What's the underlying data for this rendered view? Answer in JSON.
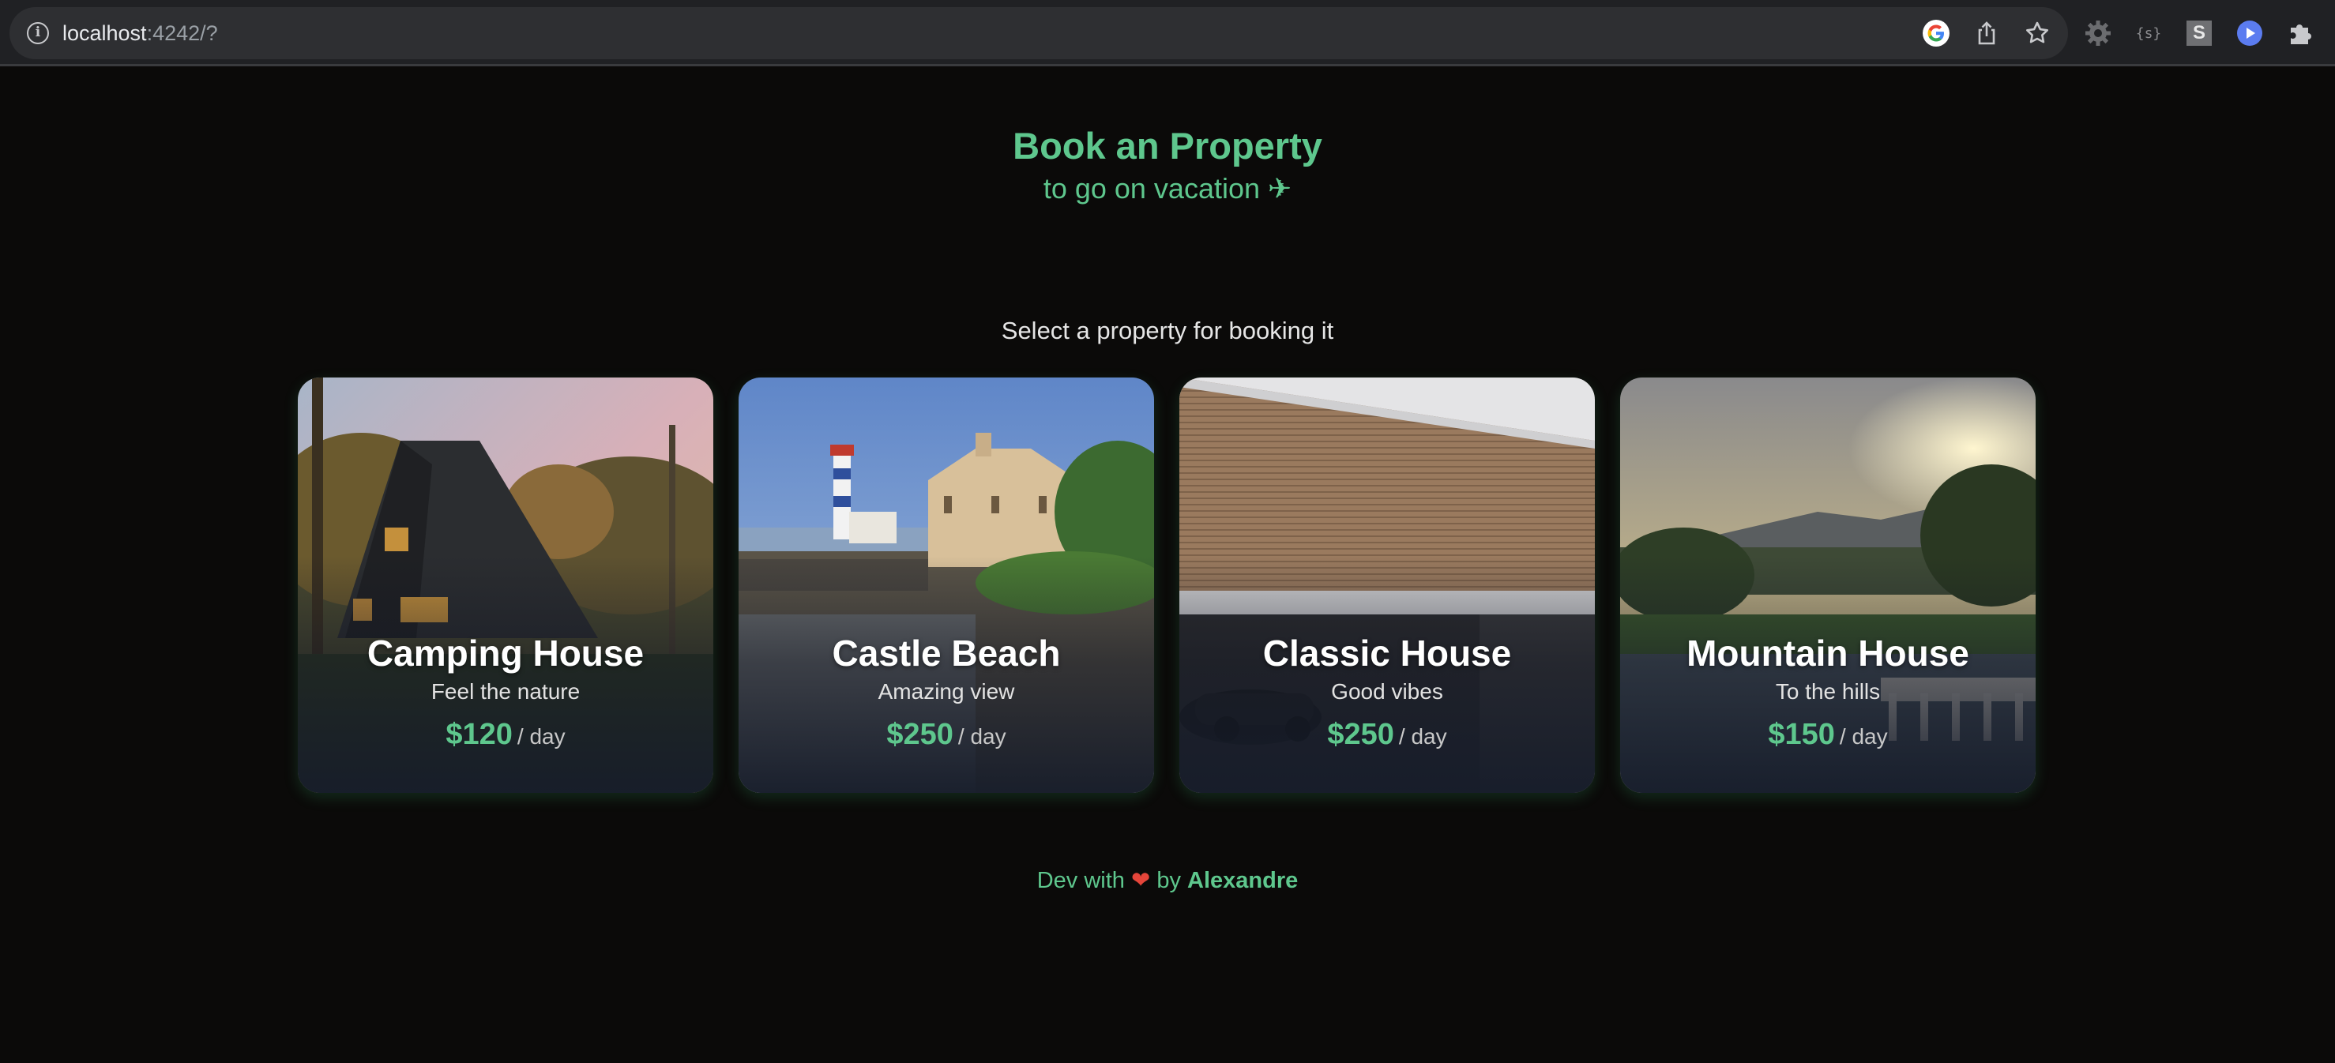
{
  "browser": {
    "url_host": "localhost",
    "url_rest": ":4242/?",
    "toolbar_icons": [
      "google-icon",
      "share-icon",
      "bookmark-star-icon"
    ],
    "extensions": [
      "gear-extension-icon",
      "json-extension-icon",
      "s-extension-icon",
      "play-extension-icon",
      "puzzle-extensions-icon"
    ]
  },
  "header": {
    "title": "Book an Property",
    "subtitle": "to go on vacation ✈"
  },
  "instruction": "Select a property for booking it",
  "properties": [
    {
      "name": "Camping House",
      "description": "Feel the nature",
      "price": "$120",
      "unit": "/ day"
    },
    {
      "name": "Castle Beach",
      "description": "Amazing view",
      "price": "$250",
      "unit": "/ day"
    },
    {
      "name": "Classic House",
      "description": "Good vibes",
      "price": "$250",
      "unit": "/ day"
    },
    {
      "name": "Mountain House",
      "description": "To the hills",
      "price": "$150",
      "unit": "/ day"
    }
  ],
  "footer": {
    "prefix": "Dev with",
    "heart": "❤",
    "by": "by",
    "author": "Alexandre"
  },
  "colors": {
    "accent": "#5ec78d",
    "background": "#0b0a09",
    "card_shade": "#161c2a"
  }
}
